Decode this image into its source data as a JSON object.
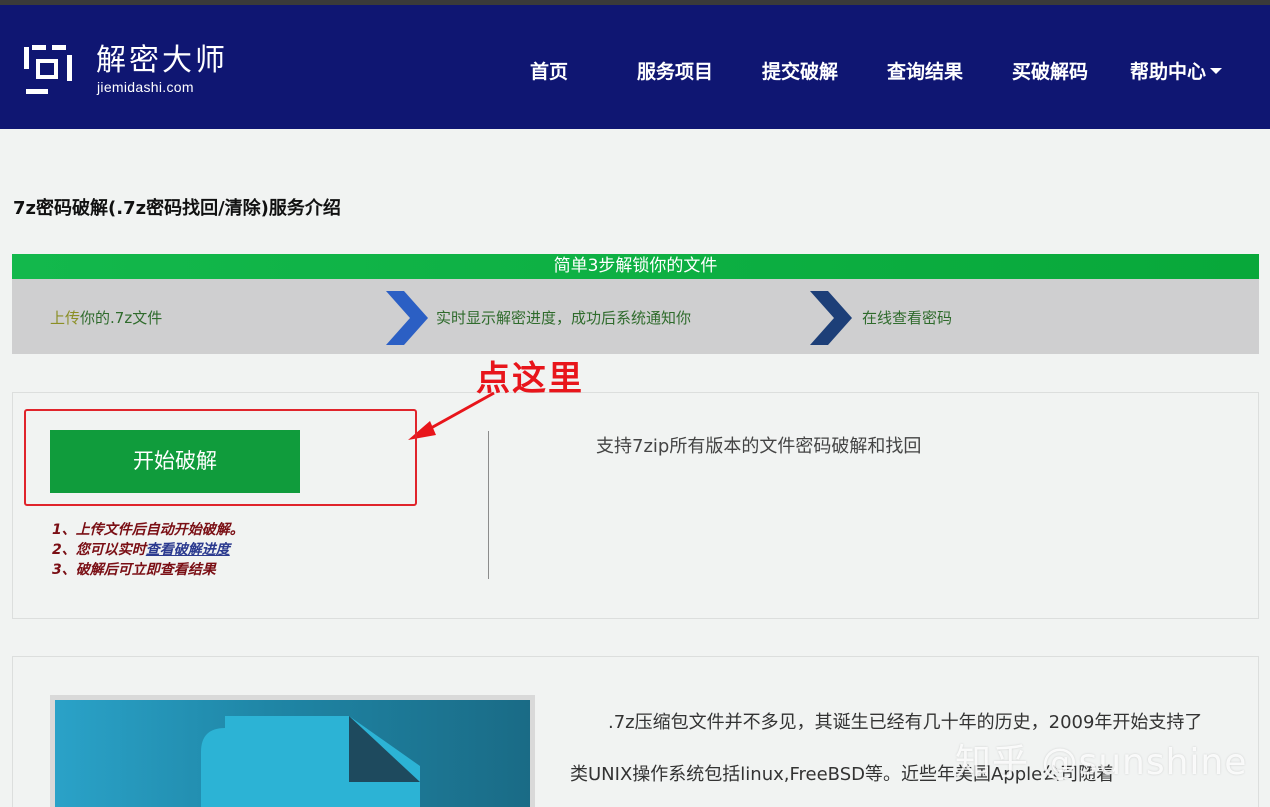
{
  "brand": {
    "name": "解密大师",
    "domain": "jiemidashi.com"
  },
  "nav": {
    "items": [
      "首页",
      "服务项目",
      "提交破解",
      "查询结果",
      "买破解码",
      "帮助中心"
    ]
  },
  "page": {
    "title": "7z密码破解(.7z密码找回/清除)服务介绍"
  },
  "steps": {
    "header": "简单3步解锁你的文件",
    "step1_highlight": "上传",
    "step1_rest": "你的.7z文件",
    "step2": "实时显示解密进度，成功后系统通知你",
    "step3": "在线查看密码"
  },
  "annotation": {
    "text": "点这里"
  },
  "action": {
    "start_button": "开始破解",
    "note1": "1、上传文件后自动开始破解。",
    "note2_prefix": "2、您可以实时",
    "note2_link": "查看破解进度",
    "note3": "3、破解后可立即查看结果",
    "support_text": "支持7zip所有版本的文件密码破解和找回"
  },
  "intro": {
    "line1": ".7z压缩包文件并不多见，其诞生已经有几十年的历史，2009年开始支持了",
    "line2": "类UNIX操作系统包括linux,FreeBSD等。近些年美国Apple公司随着"
  },
  "watermark": "知乎 @sunshine",
  "colors": {
    "header_bg": "#0f1672",
    "green_bar": "#13b84c",
    "start_button": "#109c3c",
    "annotation_red": "#e8151b",
    "chevron_blue": "#2b5fc4",
    "chevron_navy": "#1d3f78"
  }
}
